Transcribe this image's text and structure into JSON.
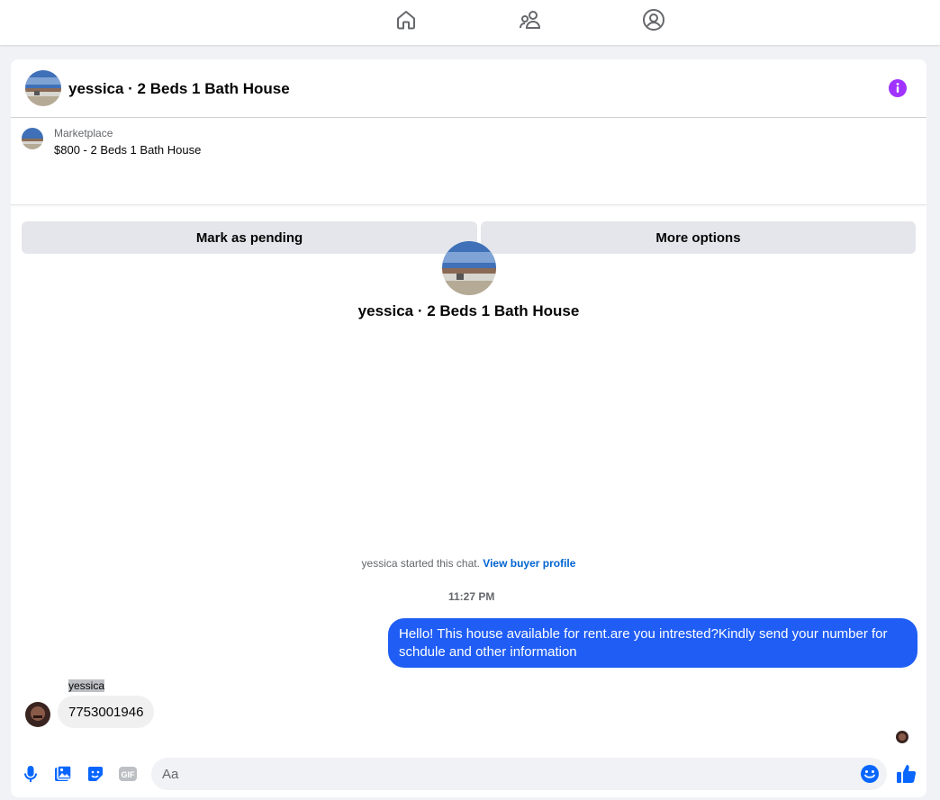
{
  "nav": {
    "items": [
      {
        "icon": "home-icon"
      },
      {
        "icon": "friends-icon"
      },
      {
        "icon": "profile-icon"
      }
    ]
  },
  "chat": {
    "title": "yessica · 2 Beds 1 Bath House",
    "info_icon": "info-icon",
    "accent_color": "#a033ff"
  },
  "listing": {
    "source": "Marketplace",
    "title": "$800 - 2 Beds 1 Bath House",
    "mark_pending_label": "Mark as pending",
    "more_options_label": "More options"
  },
  "intro": {
    "title": "yessica · 2 Beds 1 Bath House",
    "started_text": "yessica started this chat.",
    "buyer_profile_link": "View buyer profile"
  },
  "messages": {
    "timestamp": "11:27 PM",
    "outgoing": "Hello! This house available for rent.are you intrested?Kindly send your number for schdule and other information",
    "outgoing_color": "#1f5df5",
    "incoming_sender": "yessica",
    "incoming": "7753001946"
  },
  "composer": {
    "placeholder": "Aa",
    "value": "",
    "icons": [
      "mic-icon",
      "photo-icon",
      "sticker-icon",
      "gif-icon",
      "emoji-icon",
      "like-icon"
    ],
    "icon_color": "#0866ff"
  }
}
